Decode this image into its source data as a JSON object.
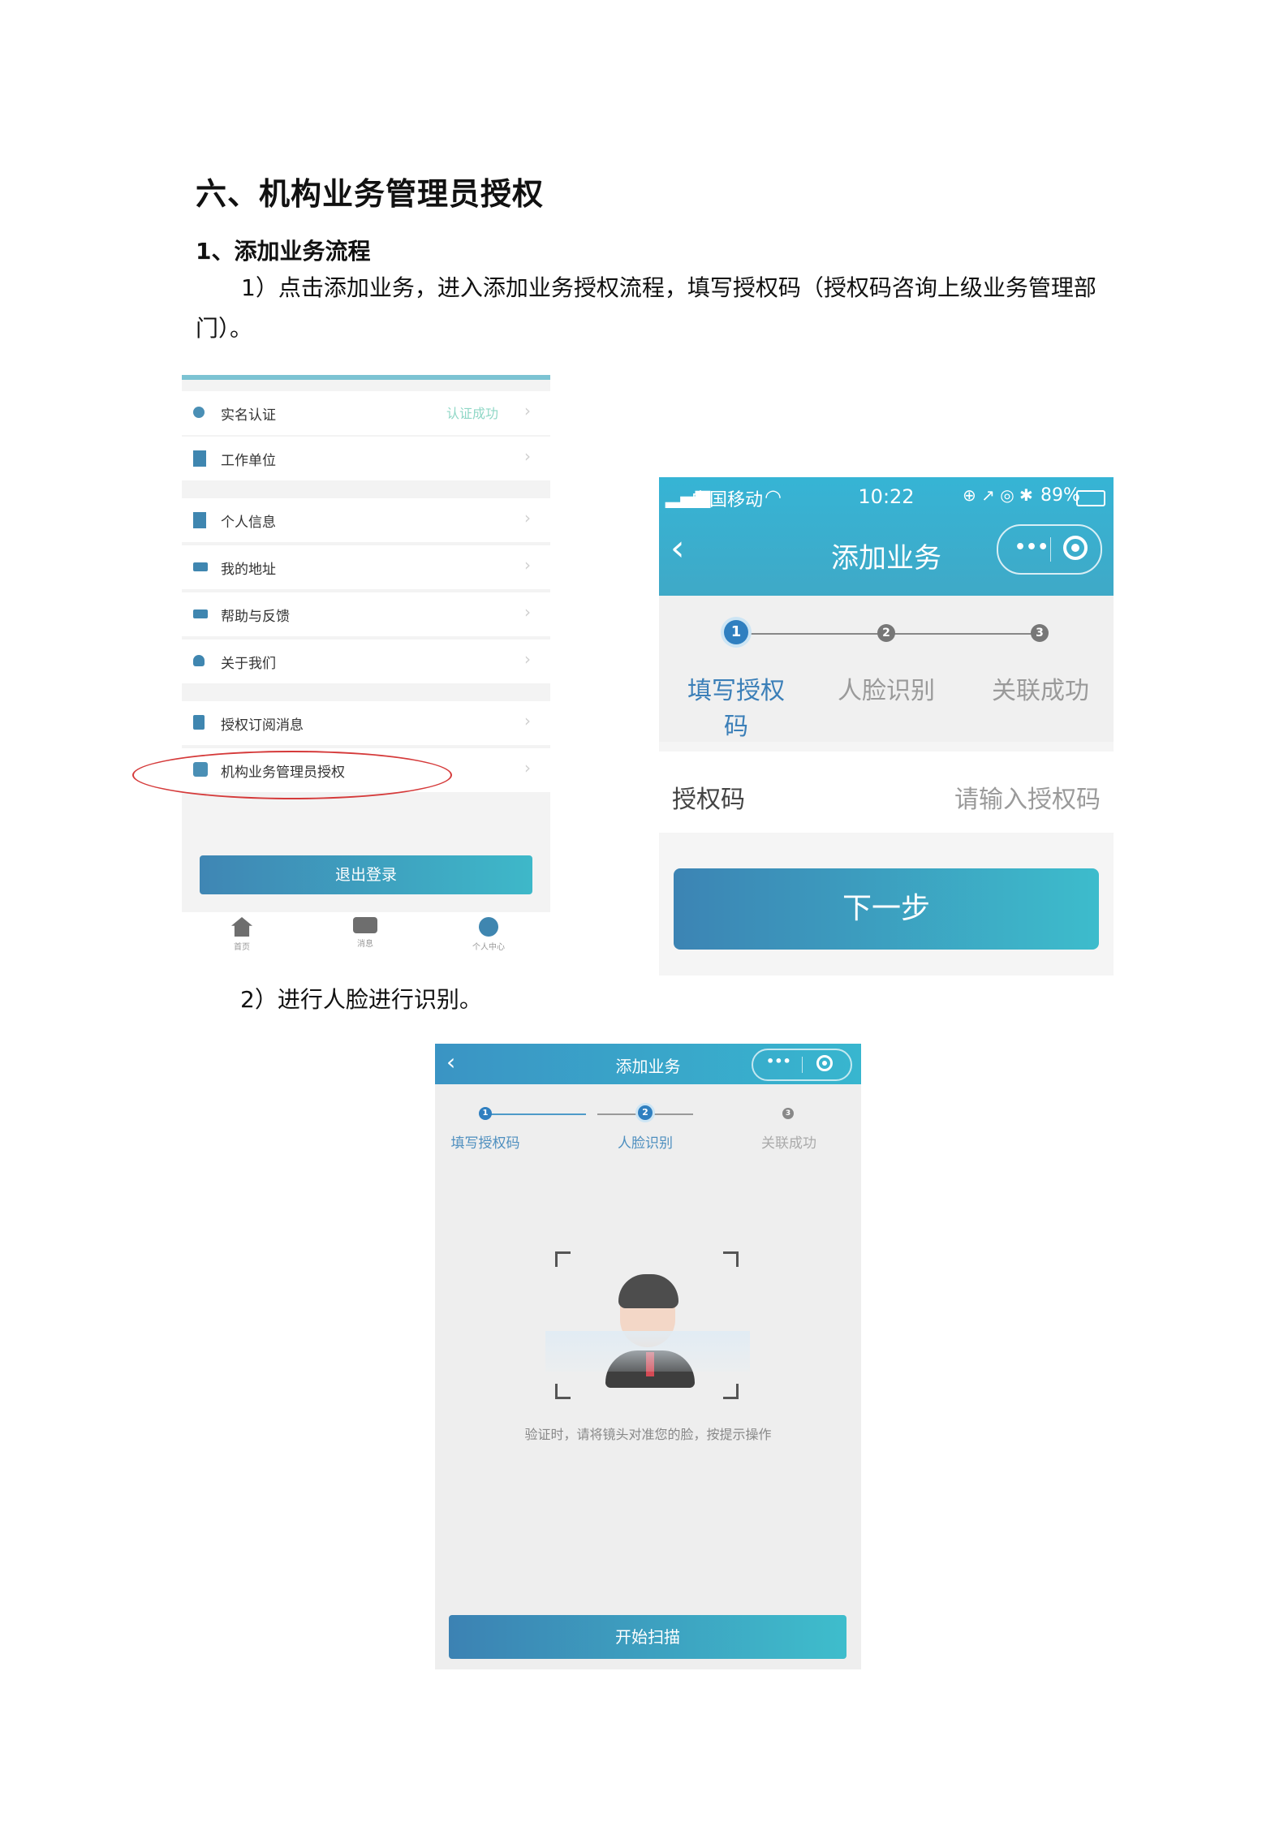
{
  "heading": "六、机构业务管理员授权",
  "subheading": "1、添加业务流程",
  "step1_text": "1）点击添加业务，进入添加业务授权流程，填写授权码（授权码咨询上级业务管理部门）。",
  "step2_text": "2）进行人脸进行识别。",
  "menu": {
    "items": [
      {
        "label": "实名认证",
        "status": "认证成功",
        "icon": "user-verified-icon"
      },
      {
        "label": "工作单位",
        "icon": "building-icon"
      },
      {
        "label": "个人信息",
        "icon": "building-icon"
      },
      {
        "label": "我的地址",
        "icon": "chat-icon"
      },
      {
        "label": "帮助与反馈",
        "icon": "chat-icon"
      },
      {
        "label": "关于我们",
        "icon": "person-icon"
      },
      {
        "label": "授权订阅消息",
        "icon": "document-icon"
      },
      {
        "label": "机构业务管理员授权",
        "icon": "admin-icon"
      }
    ],
    "chevron": "›",
    "logout": "退出登录",
    "tabs": [
      "首页",
      "消息",
      "个人中心"
    ]
  },
  "add_business": {
    "carrier": "中国移动",
    "time": "10:22",
    "battery": "89%",
    "title": "添加业务",
    "steps": [
      "填写授权码",
      "人脸识别",
      "关联成功"
    ],
    "step_numbers": [
      "1",
      "2",
      "3"
    ],
    "field_label": "授权码",
    "field_placeholder": "请输入授权码",
    "next": "下一步"
  },
  "face": {
    "title": "添加业务",
    "steps": [
      "填写授权码",
      "人脸识别",
      "关联成功"
    ],
    "step_numbers": [
      "1",
      "2",
      "3"
    ],
    "hint": "验证时，请将镜头对准您的脸，按提示操作",
    "button": "开始扫描"
  },
  "colors": {
    "accent": "#3fa9c7",
    "highlight": "#d53a3a"
  }
}
